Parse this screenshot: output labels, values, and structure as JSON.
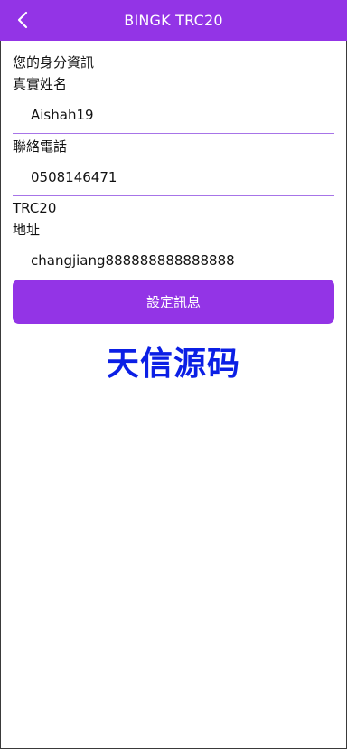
{
  "header": {
    "title": "BINGK TRC20",
    "back_icon": "chevron-left-icon"
  },
  "form": {
    "section_title": "您的身分資訊",
    "name": {
      "label": "真實姓名",
      "value": "Aishah19"
    },
    "phone": {
      "label": "聯絡電話",
      "value": "0508146471"
    },
    "address_type": "TRC20",
    "address": {
      "label": "地址",
      "value": "changjiang888888888888888"
    },
    "submit_label": "設定訊息"
  },
  "watermark": {
    "text": "天信源码"
  },
  "colors": {
    "accent": "#9334e6",
    "underline": "#a774e8",
    "watermark": "#0b1fe5"
  }
}
